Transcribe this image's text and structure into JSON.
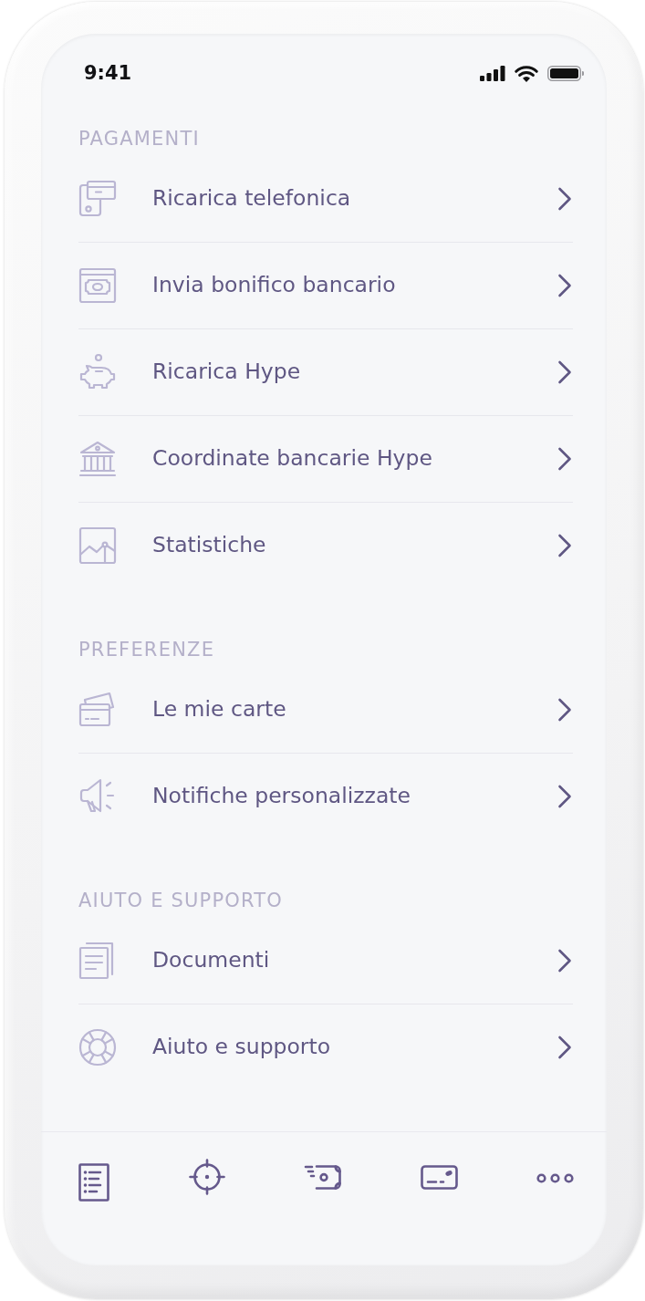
{
  "status_bar": {
    "time": "9:41"
  },
  "sections": [
    {
      "title": "PAGAMENTI",
      "items": [
        {
          "label": "Ricarica telefonica"
        },
        {
          "label": "Invia bonifico bancario"
        },
        {
          "label": "Ricarica Hype"
        },
        {
          "label": "Coordinate bancarie Hype"
        },
        {
          "label": "Statistiche"
        }
      ]
    },
    {
      "title": "PREFERENZE",
      "items": [
        {
          "label": "Le mie carte"
        },
        {
          "label": "Notifiche personalizzate"
        }
      ]
    },
    {
      "title": "AIUTO E SUPPORTO",
      "items": [
        {
          "label": "Documenti"
        },
        {
          "label": "Aiuto e supporto"
        }
      ]
    }
  ]
}
